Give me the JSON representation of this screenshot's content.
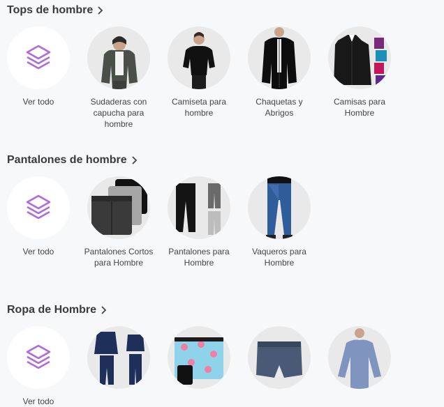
{
  "sections": [
    {
      "title": "Tops de hombre",
      "items": [
        {
          "label": "Ver todo",
          "icon": "layers-icon"
        },
        {
          "label": "Sudaderas con capucha para hombre"
        },
        {
          "label": "Camiseta para hombre"
        },
        {
          "label": "Chaquetas y Abrigos"
        },
        {
          "label": "Camisas para Hombre"
        }
      ]
    },
    {
      "title": "Pantalones de hombre",
      "items": [
        {
          "label": "Ver todo",
          "icon": "layers-icon"
        },
        {
          "label": "Pantalones Cortos para Hombre"
        },
        {
          "label": "Pantalones para Hombre"
        },
        {
          "label": "Vaqueros para Hombre"
        }
      ]
    },
    {
      "title": "Ropa de Hombre",
      "items": [
        {
          "label": "Ver todo",
          "icon": "layers-icon"
        },
        {
          "label": ""
        },
        {
          "label": ""
        },
        {
          "label": ""
        },
        {
          "label": ""
        }
      ]
    }
  ],
  "colors": {
    "accent": "#b06ad9",
    "background": "#f7f8fa",
    "tile_bg": "#e9e9e9"
  }
}
